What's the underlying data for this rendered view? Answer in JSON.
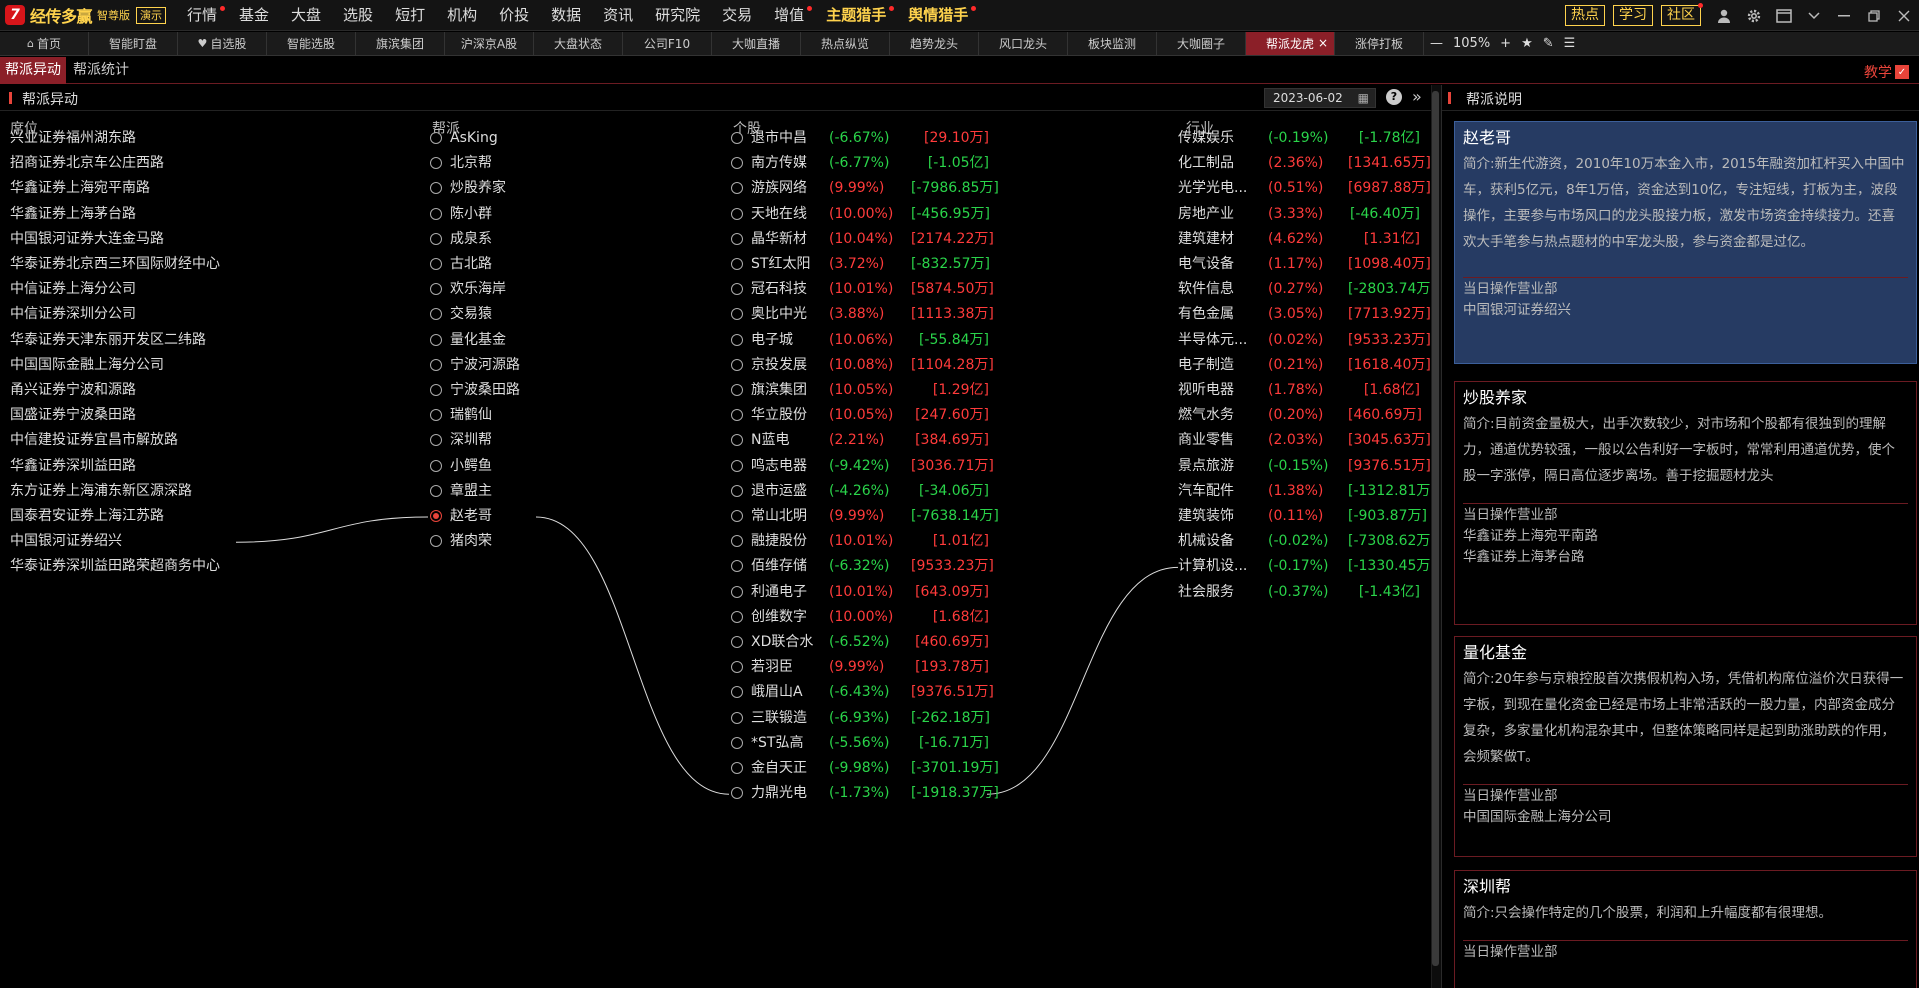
{
  "app": {
    "logo_name": "经传多赢",
    "edition": "智尊版",
    "demo": "演示"
  },
  "menu": [
    {
      "label": "行情",
      "dot": true
    },
    {
      "label": "基金",
      "dot": false
    },
    {
      "label": "大盘",
      "dot": false
    },
    {
      "label": "选股",
      "dot": false
    },
    {
      "label": "短打",
      "dot": false
    },
    {
      "label": "机构",
      "dot": false
    },
    {
      "label": "价投",
      "dot": false
    },
    {
      "label": "数据",
      "dot": false
    },
    {
      "label": "资讯",
      "dot": false
    },
    {
      "label": "研究院",
      "dot": false
    },
    {
      "label": "交易",
      "dot": false
    },
    {
      "label": "增值",
      "dot": true
    },
    {
      "label": "主题猎手",
      "dot": true,
      "gold": true
    },
    {
      "label": "舆情猎手",
      "dot": true,
      "gold": true
    }
  ],
  "top_right": {
    "hot": "热点",
    "learn": "学习",
    "community": "社区"
  },
  "tabs": [
    {
      "label": "首页",
      "icon": "home-icon"
    },
    {
      "label": "智能盯盘"
    },
    {
      "label": "自选股",
      "icon": "heart-icon"
    },
    {
      "label": "智能选股"
    },
    {
      "label": "旗滨集团"
    },
    {
      "label": "沪深京A股"
    },
    {
      "label": "大盘状态"
    },
    {
      "label": "公司F10"
    },
    {
      "label": "大咖直播"
    },
    {
      "label": "热点纵览"
    },
    {
      "label": "趋势龙头"
    },
    {
      "label": "风口龙头"
    },
    {
      "label": "板块监测"
    },
    {
      "label": "大咖圈子"
    },
    {
      "label": "帮派龙虎",
      "active": true
    },
    {
      "label": "涨停打板"
    }
  ],
  "zoom": "105%",
  "subtabs": [
    "帮派异动",
    "帮派统计"
  ],
  "teach": "教学",
  "panel": {
    "title": "帮派异动",
    "date": "2023-06-02",
    "help": "?"
  },
  "columns": {
    "seat": "席位",
    "gang": "帮派",
    "stock": "个股",
    "industry": "行业"
  },
  "seats": [
    "兴业证券福州湖东路",
    "招商证券北京车公庄西路",
    "华鑫证券上海宛平南路",
    "华鑫证券上海茅台路",
    "中国银河证券大连金马路",
    "华泰证券北京西三环国际财经中心",
    "中信证券上海分公司",
    "中信证券深圳分公司",
    "华泰证券天津东丽开发区二纬路",
    "中国国际金融上海分公司",
    "甬兴证券宁波和源路",
    "国盛证券宁波桑田路",
    "中信建投证券宜昌市解放路",
    "华鑫证券深圳益田路",
    "东方证券上海浦东新区源深路",
    "国泰君安证券上海江苏路",
    "中国银河证券绍兴",
    "华泰证券深圳益田路荣超商务中心"
  ],
  "gangs": [
    {
      "name": "AsKing"
    },
    {
      "name": "北京帮"
    },
    {
      "name": "炒股养家"
    },
    {
      "name": "陈小群"
    },
    {
      "name": "成泉系"
    },
    {
      "name": "古北路"
    },
    {
      "name": "欢乐海岸"
    },
    {
      "name": "交易猿"
    },
    {
      "name": "量化基金"
    },
    {
      "name": "宁波河源路"
    },
    {
      "name": "宁波桑田路"
    },
    {
      "name": "瑞鹤仙"
    },
    {
      "name": "深圳帮"
    },
    {
      "name": "小鳄鱼"
    },
    {
      "name": "章盟主"
    },
    {
      "name": "赵老哥",
      "selected": true
    },
    {
      "name": "猪肉荣"
    }
  ],
  "stocks": [
    {
      "name": "退市中昌",
      "pct": "(-6.67%)",
      "amt": "[29.10万]",
      "pc": "green",
      "ac": "red"
    },
    {
      "name": "南方传媒",
      "pct": "(-6.77%)",
      "amt": "[-1.05亿]",
      "pc": "green",
      "ac": "green"
    },
    {
      "name": "游族网络",
      "pct": "(9.99%)",
      "amt": "[-7986.85万]",
      "pc": "red",
      "ac": "green"
    },
    {
      "name": "天地在线",
      "pct": "(10.00%)",
      "amt": "[-456.95万]",
      "pc": "red",
      "ac": "green"
    },
    {
      "name": "晶华新材",
      "pct": "(10.04%)",
      "amt": "[2174.22万]",
      "pc": "red",
      "ac": "red"
    },
    {
      "name": "ST红太阳",
      "pct": "(3.72%)",
      "amt": "[-832.57万]",
      "pc": "red",
      "ac": "green"
    },
    {
      "name": "冠石科技",
      "pct": "(10.01%)",
      "amt": "[5874.50万]",
      "pc": "red",
      "ac": "red"
    },
    {
      "name": "奥比中光",
      "pct": "(3.88%)",
      "amt": "[1113.38万]",
      "pc": "red",
      "ac": "red"
    },
    {
      "name": "电子城",
      "pct": "(10.06%)",
      "amt": "[-55.84万]",
      "pc": "red",
      "ac": "green"
    },
    {
      "name": "京投发展",
      "pct": "(10.08%)",
      "amt": "[1104.28万]",
      "pc": "red",
      "ac": "red"
    },
    {
      "name": "旗滨集团",
      "pct": "(10.05%)",
      "amt": "[1.29亿]",
      "pc": "red",
      "ac": "red"
    },
    {
      "name": "华立股份",
      "pct": "(10.05%)",
      "amt": "[247.60万]",
      "pc": "red",
      "ac": "red"
    },
    {
      "name": "N蓝电",
      "pct": "(2.21%)",
      "amt": "[384.69万]",
      "pc": "red",
      "ac": "red"
    },
    {
      "name": "鸣志电器",
      "pct": "(-9.42%)",
      "amt": "[3036.71万]",
      "pc": "green",
      "ac": "red"
    },
    {
      "name": "退市运盛",
      "pct": "(-4.26%)",
      "amt": "[-34.06万]",
      "pc": "green",
      "ac": "green"
    },
    {
      "name": "常山北明",
      "pct": "(9.99%)",
      "amt": "[-7638.14万]",
      "pc": "red",
      "ac": "green"
    },
    {
      "name": "融捷股份",
      "pct": "(10.01%)",
      "amt": "[1.01亿]",
      "pc": "red",
      "ac": "red"
    },
    {
      "name": "佰维存储",
      "pct": "(-6.32%)",
      "amt": "[9533.23万]",
      "pc": "green",
      "ac": "red"
    },
    {
      "name": "利通电子",
      "pct": "(10.01%)",
      "amt": "[643.09万]",
      "pc": "red",
      "ac": "red"
    },
    {
      "name": "创维数字",
      "pct": "(10.00%)",
      "amt": "[1.68亿]",
      "pc": "red",
      "ac": "red"
    },
    {
      "name": "XD联合水",
      "pct": "(-6.52%)",
      "amt": "[460.69万]",
      "pc": "green",
      "ac": "red"
    },
    {
      "name": "若羽臣",
      "pct": "(9.99%)",
      "amt": "[193.78万]",
      "pc": "red",
      "ac": "red"
    },
    {
      "name": "峨眉山A",
      "pct": "(-6.43%)",
      "amt": "[9376.51万]",
      "pc": "green",
      "ac": "red"
    },
    {
      "name": "三联锻造",
      "pct": "(-6.93%)",
      "amt": "[-262.18万]",
      "pc": "green",
      "ac": "green"
    },
    {
      "name": "*ST弘高",
      "pct": "(-5.56%)",
      "amt": "[-16.71万]",
      "pc": "green",
      "ac": "green"
    },
    {
      "name": "金自天正",
      "pct": "(-9.98%)",
      "amt": "[-3701.19万]",
      "pc": "green",
      "ac": "green"
    },
    {
      "name": "力鼎光电",
      "pct": "(-1.73%)",
      "amt": "[-1918.37万]",
      "pc": "green",
      "ac": "green"
    }
  ],
  "industries": [
    {
      "name": "传媒娱乐",
      "pct": "(-0.19%)",
      "amt": "[-1.78亿]",
      "pc": "green",
      "ac": "green"
    },
    {
      "name": "化工制品",
      "pct": "(2.36%)",
      "amt": "[1341.65万]",
      "pc": "red",
      "ac": "red"
    },
    {
      "name": "光学光电...",
      "pct": "(0.51%)",
      "amt": "[6987.88万]",
      "pc": "red",
      "ac": "red"
    },
    {
      "name": "房地产业",
      "pct": "(3.33%)",
      "amt": "[-46.40万]",
      "pc": "red",
      "ac": "green"
    },
    {
      "name": "建筑建材",
      "pct": "(4.62%)",
      "amt": "[1.31亿]",
      "pc": "red",
      "ac": "red"
    },
    {
      "name": "电气设备",
      "pct": "(1.17%)",
      "amt": "[1098.40万]",
      "pc": "red",
      "ac": "red"
    },
    {
      "name": "软件信息",
      "pct": "(0.27%)",
      "amt": "[-2803.74万]",
      "pc": "red",
      "ac": "green"
    },
    {
      "name": "有色金属",
      "pct": "(3.05%)",
      "amt": "[7713.92万]",
      "pc": "red",
      "ac": "red"
    },
    {
      "name": "半导体元...",
      "pct": "(0.02%)",
      "amt": "[9533.23万]",
      "pc": "red",
      "ac": "red"
    },
    {
      "name": "电子制造",
      "pct": "(0.21%)",
      "amt": "[1618.40万]",
      "pc": "red",
      "ac": "red"
    },
    {
      "name": "视听电器",
      "pct": "(1.78%)",
      "amt": "[1.68亿]",
      "pc": "red",
      "ac": "red"
    },
    {
      "name": "燃气水务",
      "pct": "(0.20%)",
      "amt": "[460.69万]",
      "pc": "red",
      "ac": "red"
    },
    {
      "name": "商业零售",
      "pct": "(2.03%)",
      "amt": "[3045.63万]",
      "pc": "red",
      "ac": "red"
    },
    {
      "name": "景点旅游",
      "pct": "(-0.15%)",
      "amt": "[9376.51万]",
      "pc": "green",
      "ac": "red"
    },
    {
      "name": "汽车配件",
      "pct": "(1.38%)",
      "amt": "[-1312.81万]",
      "pc": "red",
      "ac": "green"
    },
    {
      "name": "建筑装饰",
      "pct": "(0.11%)",
      "amt": "[-903.87万]",
      "pc": "red",
      "ac": "green"
    },
    {
      "name": "机械设备",
      "pct": "(-0.02%)",
      "amt": "[-7308.62万]",
      "pc": "green",
      "ac": "green"
    },
    {
      "name": "计算机设...",
      "pct": "(-0.17%)",
      "amt": "[-1330.45万]",
      "pc": "green",
      "ac": "green"
    },
    {
      "name": "社会服务",
      "pct": "(-0.37%)",
      "amt": "[-1.43亿]",
      "pc": "green",
      "ac": "green"
    }
  ],
  "links": {
    "seat": 16,
    "gang": 15,
    "stock": 26,
    "industry": 17
  },
  "right_panel": {
    "title": "帮派说明",
    "cards": [
      {
        "name": "赵老哥",
        "active": true,
        "desc": "简介:新生代游资，2010年10万本金入市，2015年融资加杠杆买入中国中车，获利5亿元，8年1万倍，资金达到10亿，专注短线，打板为主，波段操作，主要参与市场风口的龙头股接力板，激发市场资金持续接力。还喜欢大手笔参与热点题材的中军龙头股，参与资金都是过亿。",
        "label": "当日操作营业部",
        "depts": [
          "中国银河证券绍兴"
        ]
      },
      {
        "name": "炒股养家",
        "active": false,
        "desc": "简介:目前资金量极大，出手次数较少，对市场和个股都有很独到的理解力，通道优势较强，一般以公告利好一字板时，常常利用通道优势，使个股一字涨停，隔日高位逐步离场。善于挖掘题材龙头",
        "label": "当日操作营业部",
        "depts": [
          "华鑫证券上海宛平南路",
          "华鑫证券上海茅台路"
        ]
      },
      {
        "name": "量化基金",
        "active": false,
        "desc": "简介:20年参与京粮控股首次携假机构入场，凭借机构席位溢价次日获得一字板，到现在量化资金已经是市场上非常活跃的一股力量，内部资金成分复杂，多家量化机构混杂其中，但整体策略同样是起到助涨助跌的作用，会频繁做T。",
        "label": "当日操作营业部",
        "depts": [
          "中国国际金融上海分公司"
        ]
      },
      {
        "name": "深圳帮",
        "active": false,
        "desc": "简介:只会操作特定的几个股票，利润和上升幅度都有很理想。",
        "label": "当日操作营业部",
        "depts": []
      }
    ]
  }
}
